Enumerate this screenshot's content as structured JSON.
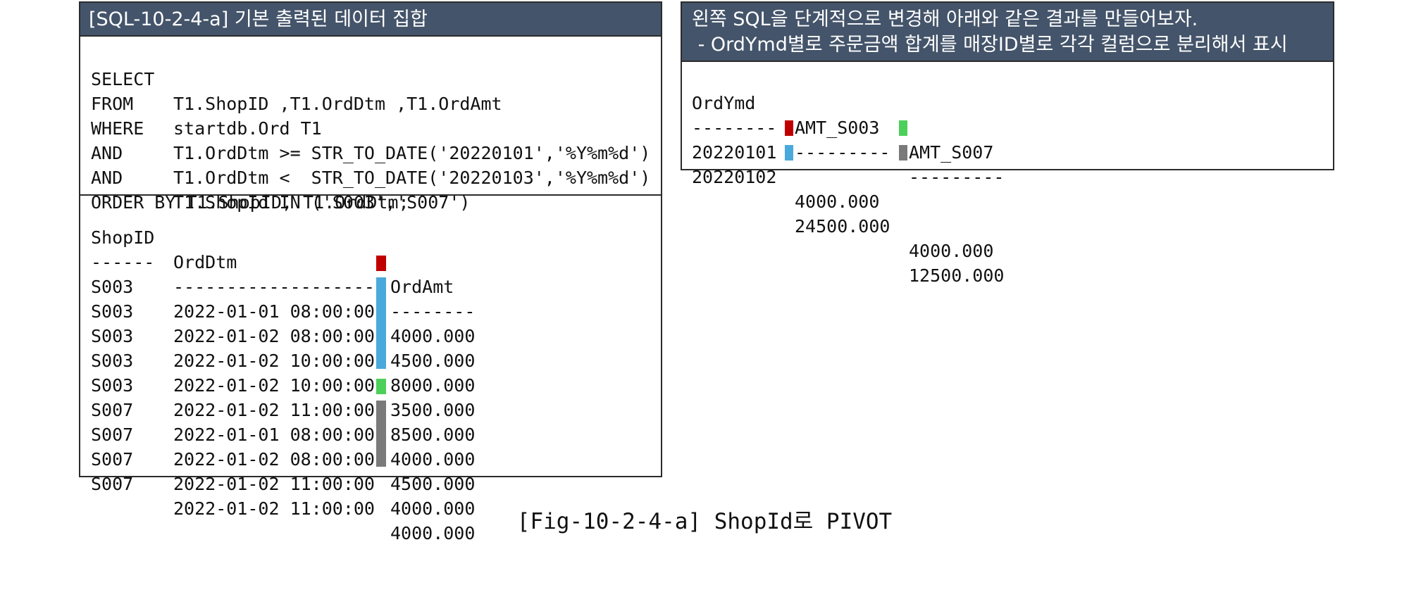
{
  "left_panel": {
    "header": "[SQL-10-2-4-a] 기본 출력된 데이터 집합",
    "sql": [
      {
        "kw": "SELECT",
        "body": "T1.ShopID ,T1.OrdDtm ,T1.OrdAmt"
      },
      {
        "kw": "FROM",
        "body": "startdb.Ord T1"
      },
      {
        "kw": "WHERE",
        "body": "T1.OrdDtm >= STR_TO_DATE('20220101','%Y%m%d')"
      },
      {
        "kw": "AND",
        "body": "T1.OrdDtm <  STR_TO_DATE('20220103','%Y%m%d')"
      },
      {
        "kw": "AND",
        "body": "T1.ShopId IN ('S003','S007')"
      },
      {
        "kw": "ORDER BY T1.ShopID, T1.OrdDtm;",
        "body": ""
      }
    ],
    "result": {
      "headers": [
        "ShopID",
        "OrdDtm",
        "OrdAmt"
      ],
      "dashes": [
        "------",
        "-------------------",
        "--------"
      ],
      "rows": [
        {
          "shop": "S003",
          "dtm": "2022-01-01 08:00:00",
          "amt": "4000.000"
        },
        {
          "shop": "S003",
          "dtm": "2022-01-02 08:00:00",
          "amt": "4500.000"
        },
        {
          "shop": "S003",
          "dtm": "2022-01-02 10:00:00",
          "amt": "8000.000"
        },
        {
          "shop": "S003",
          "dtm": "2022-01-02 10:00:00",
          "amt": "3500.000"
        },
        {
          "shop": "S003",
          "dtm": "2022-01-02 11:00:00",
          "amt": "8500.000"
        },
        {
          "shop": "S007",
          "dtm": "2022-01-01 08:00:00",
          "amt": "4000.000"
        },
        {
          "shop": "S007",
          "dtm": "2022-01-02 08:00:00",
          "amt": "4500.000"
        },
        {
          "shop": "S007",
          "dtm": "2022-01-02 11:00:00",
          "amt": "4000.000"
        },
        {
          "shop": "S007",
          "dtm": "2022-01-02 11:00:00",
          "amt": "4000.000"
        }
      ]
    }
  },
  "right_panel": {
    "header_line1": "왼쪽 SQL을 단계적으로 변경해 아래와 같은 결과를 만들어보자.",
    "header_line2": " - OrdYmd별로 주문금액 합계를 매장ID별로 각각 컬럼으로 분리해서 표시",
    "result": {
      "headers": [
        "OrdYmd",
        "AMT_S003",
        "AMT_S007"
      ],
      "dashes": [
        "--------",
        "---------",
        "---------"
      ],
      "rows": [
        {
          "ymd": "20220101",
          "s003": "4000.000",
          "s007": "4000.000"
        },
        {
          "ymd": "20220102",
          "s003": "24500.000",
          "s007": "12500.000"
        }
      ]
    }
  },
  "colors": {
    "header_bg": "#44546a",
    "red": "#c00000",
    "blue": "#4aa9dc",
    "green": "#4cd05a",
    "gray": "#7a7a7a"
  },
  "caption": "[Fig-10-2-4-a] ShopId로 PIVOT"
}
